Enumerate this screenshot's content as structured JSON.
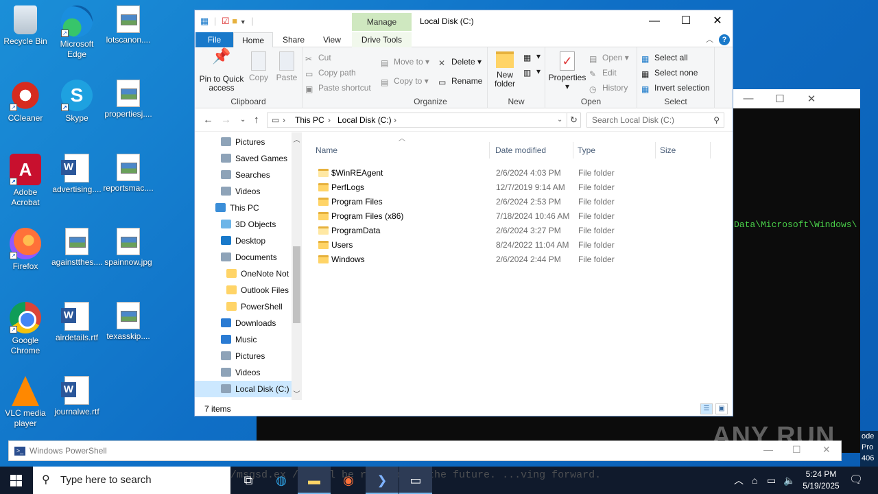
{
  "desktop": {
    "icons": [
      {
        "label": "Recycle Bin",
        "icon": "recycle-bin-icon"
      },
      {
        "label": "Microsoft Edge",
        "icon": "edge-icon"
      },
      {
        "label": "lotscanon....",
        "icon": "image-file-icon"
      },
      {
        "label": "CCleaner",
        "icon": "ccleaner-icon"
      },
      {
        "label": "Skype",
        "icon": "skype-icon"
      },
      {
        "label": "propertiesj....",
        "icon": "image-file-icon"
      },
      {
        "label": "Adobe Acrobat",
        "icon": "acrobat-icon"
      },
      {
        "label": "advertising....",
        "icon": "word-doc-icon"
      },
      {
        "label": "reportsmac....",
        "icon": "image-file-icon"
      },
      {
        "label": "Firefox",
        "icon": "firefox-icon"
      },
      {
        "label": "againstthes....",
        "icon": "image-file-icon"
      },
      {
        "label": "spainnow.jpg",
        "icon": "image-file-icon"
      },
      {
        "label": "Google Chrome",
        "icon": "chrome-icon"
      },
      {
        "label": "airdetails.rtf",
        "icon": "word-doc-icon"
      },
      {
        "label": "texasskip....",
        "icon": "image-file-icon"
      },
      {
        "label": "VLC media player",
        "icon": "vlc-icon"
      },
      {
        "label": "journalwe.rtf",
        "icon": "word-doc-icon"
      }
    ]
  },
  "terminal": {
    "visible_text": "Data\\Microsoft\\Windows\\",
    "edge_text": [
      "ode",
      "Pro",
      "406"
    ],
    "ticker_text": "/msgsd.ex /gs/c l be retired in the future.  ...ving forward."
  },
  "watermark": "ANY RUN",
  "powershell": {
    "title": "Windows PowerShell"
  },
  "explorer": {
    "title": "Local Disk (C:)",
    "manage_tab": "Manage",
    "tabs": {
      "file": "File",
      "home": "Home",
      "share": "Share",
      "view": "View",
      "drive_tools": "Drive Tools"
    },
    "ribbon": {
      "clipboard": {
        "label": "Clipboard",
        "pin": "Pin to Quick access",
        "copy": "Copy",
        "paste": "Paste",
        "cut": "Cut",
        "copy_path": "Copy path",
        "paste_shortcut": "Paste shortcut"
      },
      "organize": {
        "label": "Organize",
        "move_to": "Move to",
        "copy_to": "Copy to",
        "delete": "Delete",
        "rename": "Rename"
      },
      "new": {
        "label": "New",
        "new_folder": "New folder"
      },
      "open": {
        "label": "Open",
        "properties": "Properties",
        "open": "Open",
        "edit": "Edit",
        "history": "History"
      },
      "select": {
        "label": "Select",
        "select_all": "Select all",
        "select_none": "Select none",
        "invert": "Invert selection"
      }
    },
    "address": {
      "crumbs": [
        "This PC",
        "Local Disk (C:)"
      ]
    },
    "search_placeholder": "Search Local Disk (C:)",
    "nav": [
      {
        "label": "Pictures",
        "indent": 2
      },
      {
        "label": "Saved Games",
        "indent": 2
      },
      {
        "label": "Searches",
        "indent": 2
      },
      {
        "label": "Videos",
        "indent": 2
      },
      {
        "label": "This PC",
        "indent": 1
      },
      {
        "label": "3D Objects",
        "indent": 2
      },
      {
        "label": "Desktop",
        "indent": 2
      },
      {
        "label": "Documents",
        "indent": 2
      },
      {
        "label": "OneNote Not",
        "indent": 3
      },
      {
        "label": "Outlook Files",
        "indent": 3
      },
      {
        "label": "PowerShell",
        "indent": 3
      },
      {
        "label": "Downloads",
        "indent": 2
      },
      {
        "label": "Music",
        "indent": 2
      },
      {
        "label": "Pictures",
        "indent": 2
      },
      {
        "label": "Videos",
        "indent": 2
      },
      {
        "label": "Local Disk (C:)",
        "indent": 2,
        "selected": true
      }
    ],
    "columns": {
      "name": "Name",
      "date": "Date modified",
      "type": "Type",
      "size": "Size"
    },
    "files": [
      {
        "name": "$WinREAgent",
        "date": "2/6/2024 4:03 PM",
        "type": "File folder"
      },
      {
        "name": "PerfLogs",
        "date": "12/7/2019 9:14 AM",
        "type": "File folder"
      },
      {
        "name": "Program Files",
        "date": "2/6/2024 2:53 PM",
        "type": "File folder"
      },
      {
        "name": "Program Files (x86)",
        "date": "7/18/2024 10:46 AM",
        "type": "File folder"
      },
      {
        "name": "ProgramData",
        "date": "2/6/2024 3:27 PM",
        "type": "File folder"
      },
      {
        "name": "Users",
        "date": "8/24/2022 11:04 AM",
        "type": "File folder"
      },
      {
        "name": "Windows",
        "date": "2/6/2024 2:44 PM",
        "type": "File folder"
      }
    ],
    "status": {
      "item_count": "7 items"
    }
  },
  "taskbar": {
    "search_placeholder": "Type here to search",
    "time": "5:24 PM",
    "date": "5/19/2025"
  },
  "colors": {
    "accent": "#1979ca",
    "taskbar": "#101a2c",
    "terminal_green": "#4ad14a"
  }
}
